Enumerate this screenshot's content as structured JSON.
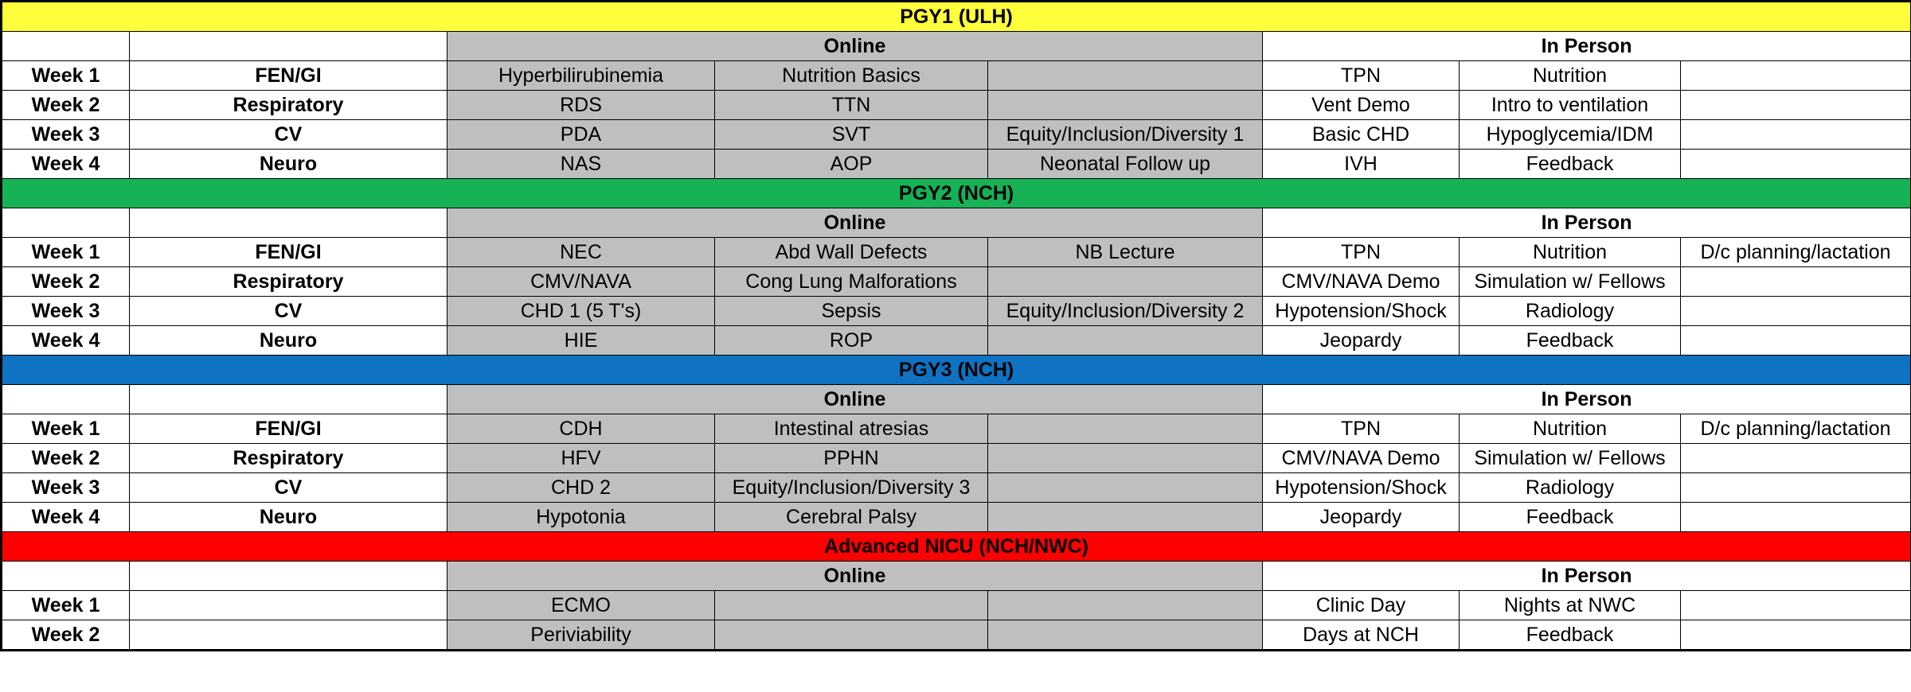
{
  "labels": {
    "online": "Online",
    "in_person": "In Person"
  },
  "colors": {
    "online_shading": "#bfbfbf",
    "pgy1_band": "#ffff3b",
    "pgy2_band": "#16b255",
    "pgy3_band": "#0f72c3",
    "advanced_band": "#ff0000"
  },
  "sections": [
    {
      "title": "PGY1 (ULH)",
      "rows": [
        {
          "week": "Week 1",
          "topic": "FEN/GI",
          "online": [
            "Hyperbilirubinemia",
            "Nutrition Basics",
            ""
          ],
          "in_person": [
            "TPN",
            "Nutrition",
            ""
          ]
        },
        {
          "week": "Week 2",
          "topic": "Respiratory",
          "online": [
            "RDS",
            "TTN",
            ""
          ],
          "in_person": [
            "Vent Demo",
            "Intro to ventilation",
            ""
          ]
        },
        {
          "week": "Week 3",
          "topic": "CV",
          "online": [
            "PDA",
            "SVT",
            "Equity/Inclusion/Diversity 1"
          ],
          "in_person": [
            "Basic CHD",
            "Hypoglycemia/IDM",
            ""
          ]
        },
        {
          "week": "Week 4",
          "topic": "Neuro",
          "online": [
            "NAS",
            "AOP",
            "Neonatal Follow up"
          ],
          "in_person": [
            "IVH",
            "Feedback",
            ""
          ]
        }
      ]
    },
    {
      "title": "PGY2 (NCH)",
      "rows": [
        {
          "week": "Week 1",
          "topic": "FEN/GI",
          "online": [
            "NEC",
            "Abd Wall Defects",
            "NB Lecture"
          ],
          "in_person": [
            "TPN",
            "Nutrition",
            "D/c planning/lactation"
          ]
        },
        {
          "week": "Week 2",
          "topic": "Respiratory",
          "online": [
            "CMV/NAVA",
            "Cong Lung Malforations",
            ""
          ],
          "in_person": [
            "CMV/NAVA Demo",
            "Simulation w/ Fellows",
            ""
          ]
        },
        {
          "week": "Week 3",
          "topic": "CV",
          "online": [
            "CHD 1 (5 T's)",
            "Sepsis",
            "Equity/Inclusion/Diversity 2"
          ],
          "in_person": [
            "Hypotension/Shock",
            "Radiology",
            ""
          ]
        },
        {
          "week": "Week 4",
          "topic": "Neuro",
          "online": [
            "HIE",
            "ROP",
            ""
          ],
          "in_person": [
            "Jeopardy",
            "Feedback",
            ""
          ]
        }
      ]
    },
    {
      "title": "PGY3 (NCH)",
      "rows": [
        {
          "week": "Week 1",
          "topic": "FEN/GI",
          "online": [
            "CDH",
            "Intestinal atresias",
            ""
          ],
          "in_person": [
            "TPN",
            "Nutrition",
            "D/c planning/lactation"
          ]
        },
        {
          "week": "Week 2",
          "topic": "Respiratory",
          "online": [
            "HFV",
            "PPHN",
            ""
          ],
          "in_person": [
            "CMV/NAVA Demo",
            "Simulation w/ Fellows",
            ""
          ]
        },
        {
          "week": "Week 3",
          "topic": "CV",
          "online": [
            "CHD 2",
            "Equity/Inclusion/Diversity 3",
            ""
          ],
          "in_person": [
            "Hypotension/Shock",
            "Radiology",
            ""
          ]
        },
        {
          "week": "Week 4",
          "topic": "Neuro",
          "online": [
            "Hypotonia",
            "Cerebral Palsy",
            ""
          ],
          "in_person": [
            "Jeopardy",
            "Feedback",
            ""
          ]
        }
      ]
    },
    {
      "title": "Advanced NICU (NCH/NWC)",
      "rows": [
        {
          "week": "Week 1",
          "topic": "",
          "online": [
            "ECMO",
            "",
            ""
          ],
          "in_person": [
            "Clinic Day",
            "Nights at NWC",
            ""
          ]
        },
        {
          "week": "Week 2",
          "topic": "",
          "online": [
            "Periviability",
            "",
            ""
          ],
          "in_person": [
            "Days at NCH",
            "Feedback",
            ""
          ]
        }
      ]
    }
  ]
}
